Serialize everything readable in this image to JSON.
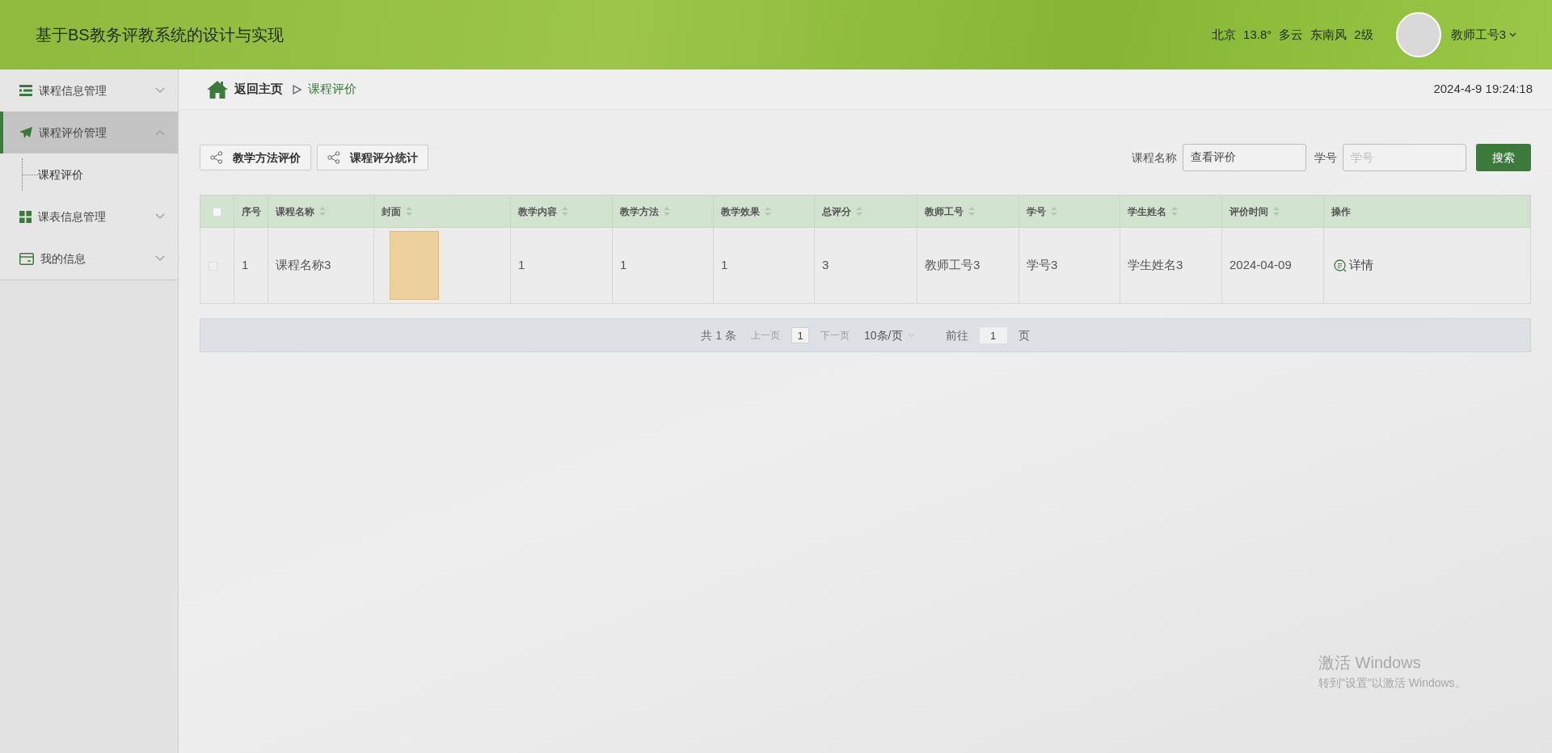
{
  "header": {
    "title": "基于BS教务评教系统的设计与实现",
    "weather": [
      "北京",
      "13.8°",
      "多云",
      "东南风",
      "2级"
    ],
    "user": "教师工号3"
  },
  "sidebar": {
    "items": [
      {
        "label": "课程信息管理",
        "kind": "list",
        "expanded": false,
        "selected": false
      },
      {
        "label": "课程评价管理",
        "kind": "plane",
        "expanded": true,
        "selected": true,
        "children": [
          {
            "label": "课程评价",
            "selected": false
          }
        ]
      },
      {
        "label": "课表信息管理",
        "kind": "grid",
        "expanded": false,
        "selected": false
      },
      {
        "label": "我的信息",
        "kind": "card",
        "expanded": false,
        "selected": false
      }
    ]
  },
  "breadcrumb": {
    "home": "返回主页",
    "current": "课程评价",
    "datetime": "2024-4-9 19:24:18"
  },
  "toolbar": {
    "buttons": [
      "教学方法评价",
      "课程评分统计"
    ],
    "search": [
      {
        "label": "课程名称",
        "value": "查看评价"
      },
      {
        "label": "学号",
        "placeholder": "学号"
      }
    ],
    "search_button": "搜索"
  },
  "table": {
    "select_all_checked": false,
    "columns": [
      {
        "label": "序号",
        "sortable": false
      },
      {
        "label": "课程名称",
        "sortable": true
      },
      {
        "label": "封面",
        "sortable": true
      },
      {
        "label": "教学内容",
        "sortable": true
      },
      {
        "label": "教学方法",
        "sortable": true
      },
      {
        "label": "教学效果",
        "sortable": true
      },
      {
        "label": "总评分",
        "sortable": true
      },
      {
        "label": "教师工号",
        "sortable": true
      },
      {
        "label": "学号",
        "sortable": true
      },
      {
        "label": "学生姓名",
        "sortable": true
      },
      {
        "label": "评价时间",
        "sortable": true
      },
      {
        "label": "操作",
        "sortable": false
      }
    ],
    "rows": [
      {
        "checked": false,
        "cells": [
          "1",
          "课程名称3",
          null,
          "1",
          "1",
          "1",
          "3",
          "教师工号3",
          "学号3",
          "学生姓名3",
          "2024-04-09"
        ],
        "action": "详情"
      }
    ]
  },
  "pagination": {
    "total": "共 1 条",
    "prev": "上一页",
    "page": "1",
    "next": "下一页",
    "page_size": "10条/页",
    "goto": "前往",
    "goto_value": "1",
    "goto_unit": "页"
  },
  "os_notice": {
    "title": "激活 Windows",
    "subtitle": "转到\"设置\"以激活 Windows。"
  }
}
